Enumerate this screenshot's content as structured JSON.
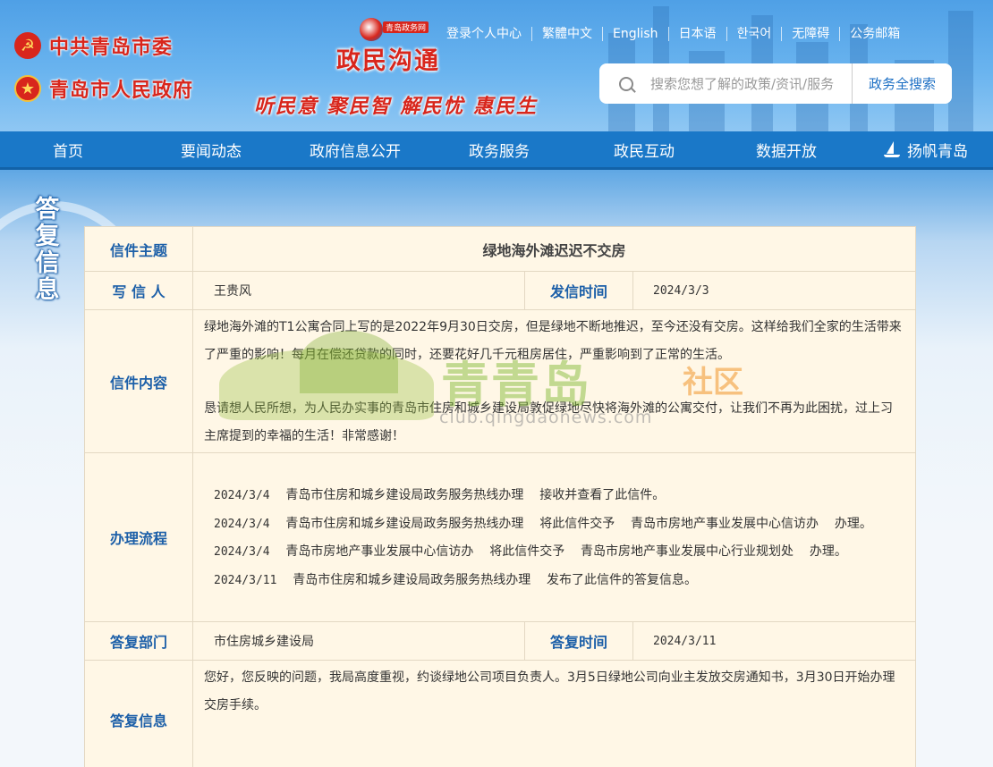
{
  "header": {
    "party_label": "中共青岛市委",
    "gov_label": "青岛市人民政府",
    "brand_small": "青岛政务网",
    "brand_name": "政民沟通",
    "slogan": "听民意 聚民智 解民忧 惠民生",
    "top_links": [
      "登录个人中心",
      "繁體中文",
      "English",
      "日本语",
      "한국어",
      "无障碍",
      "公务邮箱"
    ],
    "search_placeholder": "搜索您想了解的政策/资讯/服务",
    "search_button": "政务全搜索"
  },
  "nav": {
    "items": [
      "首页",
      "要闻动态",
      "政府信息公开",
      "政务服务",
      "政民互动",
      "数据开放",
      "扬帆青岛"
    ]
  },
  "side_title": "答复信息",
  "letter": {
    "subject_label": "信件主题",
    "subject": "绿地海外滩迟迟不交房",
    "writer_label": "写 信 人",
    "writer": "王贵风",
    "sent_time_label": "发信时间",
    "sent_time": "2024/3/3",
    "content_label": "信件内容",
    "content_p1": "绿地海外滩的T1公寓合同上写的是2022年9月30日交房，但是绿地不断地推迟，至今还没有交房。这样给我们全家的生活带来了严重的影响！每月在偿还贷款的同时，还要花好几千元租房居住，严重影响到了正常的生活。",
    "content_p2": "恳请想人民所想，为人民办实事的青岛市住房和城乡建设局敦促绿地尽快将海外滩的公寓交付，让我们不再为此困扰，过上习主席提到的幸福的生活！非常感谢！",
    "process_label": "办理流程",
    "process": [
      {
        "date": "2024/3/4",
        "text": "    青岛市住房和城乡建设局政务服务热线办理    接收并查看了此信件。"
      },
      {
        "date": "2024/3/4",
        "text": "    青岛市住房和城乡建设局政务服务热线办理    将此信件交予    青岛市房地产事业发展中心信访办    办理。"
      },
      {
        "date": "2024/3/4",
        "text": "    青岛市房地产事业发展中心信访办    将此信件交予    青岛市房地产事业发展中心行业规划处    办理。"
      },
      {
        "date": "2024/3/11",
        "text": "    青岛市住房和城乡建设局政务服务热线办理    发布了此信件的答复信息。"
      }
    ],
    "reply_dept_label": "答复部门",
    "reply_dept": "市住房城乡建设局",
    "reply_time_label": "答复时间",
    "reply_time": "2024/3/11",
    "reply_label": "答复信息",
    "reply": "您好，您反映的问题，我局高度重视，约谈绿地公司项目负责人。3月5日绿地公司向业主发放交房通知书，3月30日开始办理交房手续。"
  },
  "watermark": {
    "big": "青青岛",
    "she": "社区",
    "url": "club.qingdaonews.com"
  }
}
